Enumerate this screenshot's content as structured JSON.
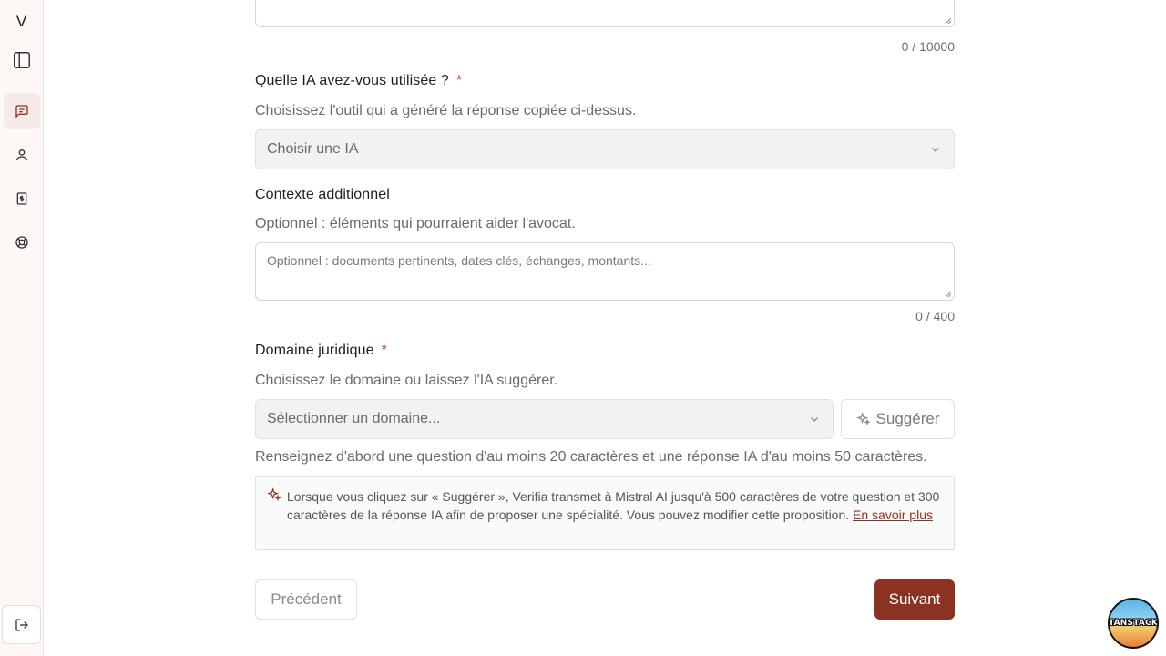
{
  "sidebar": {
    "logo": "V",
    "items": [
      {
        "name": "toggle-sidebar",
        "icon": "panel-left-icon"
      },
      {
        "name": "conversations",
        "icon": "message-square-icon",
        "active": true
      },
      {
        "name": "profile",
        "icon": "user-icon"
      },
      {
        "name": "billing",
        "icon": "receipt-dollar-icon"
      },
      {
        "name": "support",
        "icon": "lifebuoy-icon"
      }
    ],
    "logout_icon": "log-out-icon"
  },
  "form": {
    "answer_counter": "0 / 10000",
    "ai_field": {
      "label": "Quelle IA avez-vous utilisée ?",
      "required_mark": "*",
      "help": "Choisissez l'outil qui a généré la réponse copiée ci-dessus.",
      "placeholder": "Choisir une IA"
    },
    "context_field": {
      "label": "Contexte additionnel",
      "help": "Optionnel : éléments qui pourraient aider l'avocat.",
      "placeholder": "Optionnel : documents pertinents, dates clés, échanges, montants...",
      "counter": "0 / 400"
    },
    "domain_field": {
      "label": "Domaine juridique",
      "required_mark": "*",
      "help": "Choisissez le domaine ou laissez l'IA suggérer.",
      "placeholder": "Sélectionner un domaine...",
      "suggest_label": "Suggérer",
      "hint": "Renseignez d'abord une question d'au moins 20 caractères et une réponse IA d'au moins 50 caractères."
    },
    "info": {
      "text": "Lorsque vous cliquez sur « Suggérer », Verifia transmet à Mistral AI jusqu'à 500 caractères de votre question et 300 caractères de la réponse IA afin de proposer une spécialité. Vous pouvez modifier cette proposition. ",
      "link": "En savoir plus"
    },
    "prev_label": "Précédent",
    "next_label": "Suivant"
  },
  "badge": {
    "text": "TANSTACK"
  },
  "colors": {
    "accent": "#8b3322",
    "required": "#c0392b",
    "sidebar_bg": "#fdf8f6"
  }
}
